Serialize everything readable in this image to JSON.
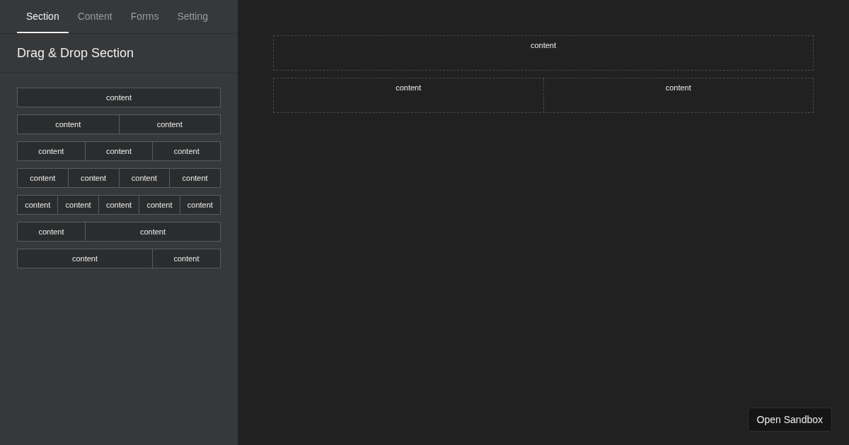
{
  "tabs": [
    {
      "label": "Section",
      "selected": true
    },
    {
      "label": "Content",
      "selected": false
    },
    {
      "label": "Forms",
      "selected": false
    },
    {
      "label": "Setting",
      "selected": false
    }
  ],
  "sidebar": {
    "title": "Drag & Drop Section",
    "layouts": [
      {
        "cells": [
          "content"
        ]
      },
      {
        "cells": [
          "content",
          "content"
        ]
      },
      {
        "cells": [
          "content",
          "content",
          "content"
        ]
      },
      {
        "cells": [
          "content",
          "content",
          "content",
          "content"
        ]
      },
      {
        "cells": [
          "content",
          "content",
          "content",
          "content",
          "content"
        ]
      },
      {
        "cells": [
          "content",
          "content"
        ]
      },
      {
        "cells": [
          "content",
          "content"
        ]
      }
    ]
  },
  "canvas": {
    "rows": [
      {
        "cells": [
          "content"
        ]
      },
      {
        "cells": [
          "content",
          "content"
        ]
      }
    ]
  },
  "sandbox_button": "Open Sandbox"
}
